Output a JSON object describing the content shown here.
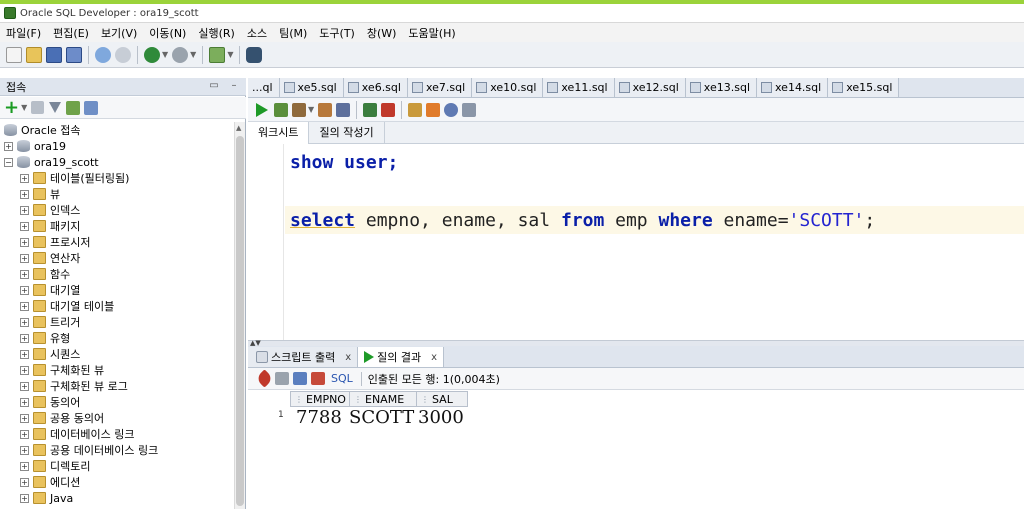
{
  "window": {
    "title": "Oracle SQL Developer : ora19_scott"
  },
  "menu": [
    "파일(F)",
    "편집(E)",
    "보기(V)",
    "이동(N)",
    "실행(R)",
    "소스",
    "팀(M)",
    "도구(T)",
    "창(W)",
    "도움말(H)"
  ],
  "connections_panel": {
    "title": "접속",
    "tree": [
      {
        "label": "Oracle 접속",
        "level": 0,
        "icon": "db-icon"
      },
      {
        "label": "ora19",
        "level": 1,
        "icon": "db-icon"
      },
      {
        "label": "ora19_scott",
        "level": 1,
        "icon": "db-icon"
      },
      {
        "label": "테이블(필터링됨)",
        "level": 2,
        "icon": "folder-icon"
      },
      {
        "label": "뷰",
        "level": 2,
        "icon": "folder-icon"
      },
      {
        "label": "인덱스",
        "level": 2,
        "icon": "folder-icon"
      },
      {
        "label": "패키지",
        "level": 2,
        "icon": "folder-icon"
      },
      {
        "label": "프로시저",
        "level": 2,
        "icon": "folder-icon"
      },
      {
        "label": "연산자",
        "level": 2,
        "icon": "folder-icon"
      },
      {
        "label": "함수",
        "level": 2,
        "icon": "folder-icon"
      },
      {
        "label": "대기열",
        "level": 2,
        "icon": "folder-icon"
      },
      {
        "label": "대기열 테이블",
        "level": 2,
        "icon": "folder-icon"
      },
      {
        "label": "트리거",
        "level": 2,
        "icon": "folder-icon"
      },
      {
        "label": "유형",
        "level": 2,
        "icon": "folder-icon"
      },
      {
        "label": "시퀀스",
        "level": 2,
        "icon": "folder-icon"
      },
      {
        "label": "구체화된 뷰",
        "level": 2,
        "icon": "folder-icon"
      },
      {
        "label": "구체화된 뷰 로그",
        "level": 2,
        "icon": "folder-icon"
      },
      {
        "label": "동의어",
        "level": 2,
        "icon": "folder-icon"
      },
      {
        "label": "공용 동의어",
        "level": 2,
        "icon": "folder-icon"
      },
      {
        "label": "데이터베이스 링크",
        "level": 2,
        "icon": "folder-icon"
      },
      {
        "label": "공용 데이터베이스 링크",
        "level": 2,
        "icon": "folder-icon"
      },
      {
        "label": "디렉토리",
        "level": 2,
        "icon": "folder-icon"
      },
      {
        "label": "에디션",
        "level": 2,
        "icon": "folder-icon"
      },
      {
        "label": "Java",
        "level": 2,
        "icon": "folder-icon"
      }
    ]
  },
  "editor_tabs": [
    "...ql",
    "xe5.sql",
    "xe6.sql",
    "xe7.sql",
    "xe10.sql",
    "xe11.sql",
    "xe12.sql",
    "xe13.sql",
    "xe14.sql",
    "xe15.sql"
  ],
  "editor_subtabs": [
    "워크시트",
    "질의 작성기"
  ],
  "editor": {
    "line1_kw": "show user;",
    "line2": {
      "select": "select",
      "cols": " empno, ename, sal ",
      "from": "from",
      "table": " emp ",
      "where": "where",
      "cond": " ename=",
      "literal": "'SCOTT'",
      "end": ";"
    }
  },
  "results": {
    "tabs": [
      "스크립트 출력",
      "질의 결과"
    ],
    "close_glyph": "x",
    "toolbar_sql": "SQL",
    "status": "인출된 모든 행: 1(0,004초)",
    "columns": [
      "EMPNO",
      "ENAME",
      "SAL"
    ],
    "rows": [
      {
        "num": "1",
        "values": [
          "7788",
          "SCOTT",
          "3000"
        ]
      }
    ]
  }
}
